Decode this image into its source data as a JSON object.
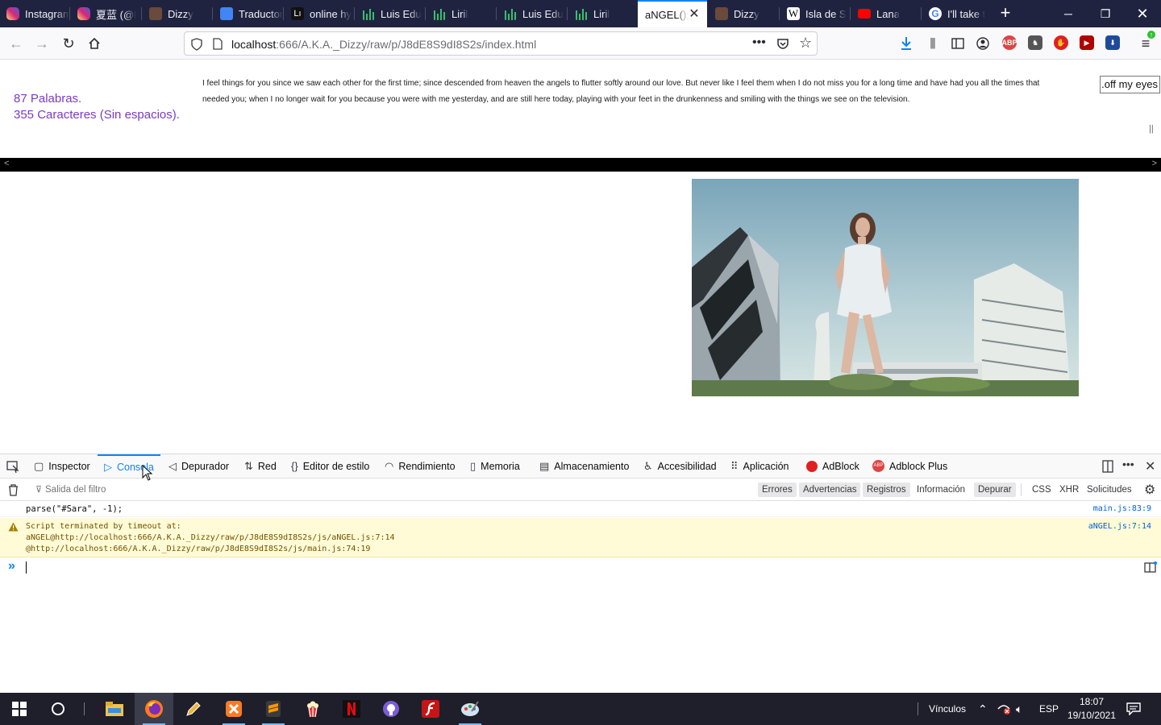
{
  "browser": {
    "tabs": [
      {
        "label": "Instagram",
        "icon": "instagram-icon"
      },
      {
        "label": "夏蓝 (@l",
        "icon": "instagram-icon"
      },
      {
        "label": "Dizzy",
        "icon": "pencil-favicon-icon"
      },
      {
        "label": "Traductor",
        "icon": "google-translate-icon"
      },
      {
        "label": "online hy",
        "icon": "letter-l-favicon-icon"
      },
      {
        "label": "Luis Edu",
        "icon": "chart-bars-favicon-icon"
      },
      {
        "label": "Liril",
        "icon": "chart-bars-favicon-icon"
      },
      {
        "label": "Luis Edu",
        "icon": "chart-bars-favicon-icon"
      },
      {
        "label": "Liril",
        "icon": "chart-bars-favicon-icon"
      },
      {
        "label": "aNGEL();",
        "icon": "",
        "active": true
      },
      {
        "label": "Dizzy",
        "icon": "pencil-favicon-icon"
      },
      {
        "label": "Isla de S",
        "icon": "wikipedia-icon"
      },
      {
        "label": "Lana",
        "icon": "youtube-icon"
      },
      {
        "label": "I'll take t",
        "icon": "google-icon"
      }
    ],
    "url_host": "localhost",
    "url_path": ":666/A.K.A._Dizzy/raw/p/J8dE8S9dI8S2s/index.html"
  },
  "page": {
    "word_count": "87 Palabras.",
    "char_count": "355 Caracteres (Sin espacios).",
    "poem_line1": "I feel things for you since we saw each other for the first time; since descended from heaven the angels to flutter softly around our love. But never like I feel them when I do not miss you for a long time and have had you all the times that",
    "poem_line2": "needed you; when I no longer wait for you because you were with me yesterday, and are still here today, playing with your feet in the drunkenness and smiling with the things we see on the television.",
    "marquee_text": "off my eyes.",
    "pause_mark": "||",
    "scroll_left": "<",
    "scroll_right": ">"
  },
  "devtools": {
    "tabs": [
      {
        "label": "Inspector",
        "icon": "inspector-icon"
      },
      {
        "label": "Consola",
        "icon": "console-icon",
        "active": true
      },
      {
        "label": "Depurador",
        "icon": "debugger-icon"
      },
      {
        "label": "Red",
        "icon": "network-icon"
      },
      {
        "label": "Editor de estilo",
        "icon": "braces-icon"
      },
      {
        "label": "Rendimiento",
        "icon": "gauge-icon"
      },
      {
        "label": "Memoria",
        "icon": "memory-icon"
      },
      {
        "label": "Almacenamiento",
        "icon": "storage-icon"
      },
      {
        "label": "Accesibilidad",
        "icon": "accessibility-icon"
      },
      {
        "label": "Aplicación",
        "icon": "grid-icon"
      },
      {
        "label": "AdBlock",
        "icon": "adblock-icon"
      },
      {
        "label": "Adblock Plus",
        "icon": "abp-icon"
      }
    ],
    "filter_placeholder": "Salida del filtro",
    "filters": [
      {
        "label": "Errores",
        "on": true
      },
      {
        "label": "Advertencias",
        "on": true
      },
      {
        "label": "Registros",
        "on": true
      },
      {
        "label": "Información",
        "on": false
      },
      {
        "label": "Depurar",
        "on": true
      }
    ],
    "filters_net": [
      "CSS",
      "XHR",
      "Solicitudes"
    ],
    "log_line": "parse(\"#Sara\", -1);",
    "log_source": "main.js:83:9",
    "warn_line1": "Script terminated by timeout at:",
    "warn_line2": "aNGEL@http://localhost:666/A.K.A._Dizzy/raw/p/J8dE8S9dI8S2s/js/aNGEL.js:7:14",
    "warn_line3": "@http://localhost:666/A.K.A._Dizzy/raw/p/J8dE8S9dI8S2s/js/main.js:74:19",
    "warn_source": "aNGEL.js:7:14",
    "prompt": "»"
  },
  "taskbar": {
    "links_label": "Vínculos",
    "language": "ESP",
    "time": "18:07",
    "date": "19/10/2021"
  }
}
